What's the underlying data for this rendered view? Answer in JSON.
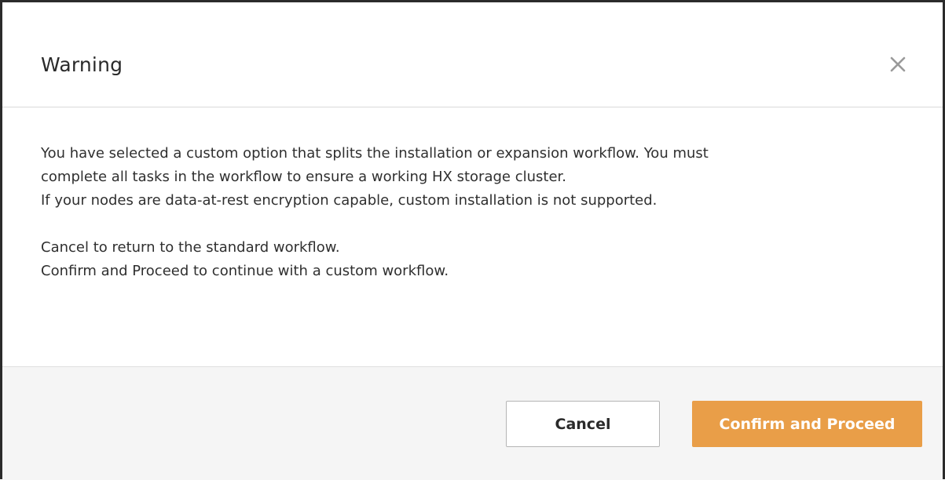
{
  "dialog": {
    "title": "Warning",
    "close_icon": "close-icon",
    "lines": [
      "You have selected a custom option that splits the installation or expansion workflow. You must",
      "complete all tasks in the workflow to ensure a working HX storage cluster.",
      "If your nodes are data-at-rest encryption capable, custom installation is not supported.",
      "Cancel to return to the standard workflow.",
      "Confirm and Proceed to continue with a custom workflow."
    ],
    "cancel_label": "Cancel",
    "confirm_label": "Confirm and Proceed"
  },
  "colors": {
    "confirm_bg": "#e99e48",
    "footer_bg": "#f5f5f5",
    "border": "#2b2b2b"
  }
}
